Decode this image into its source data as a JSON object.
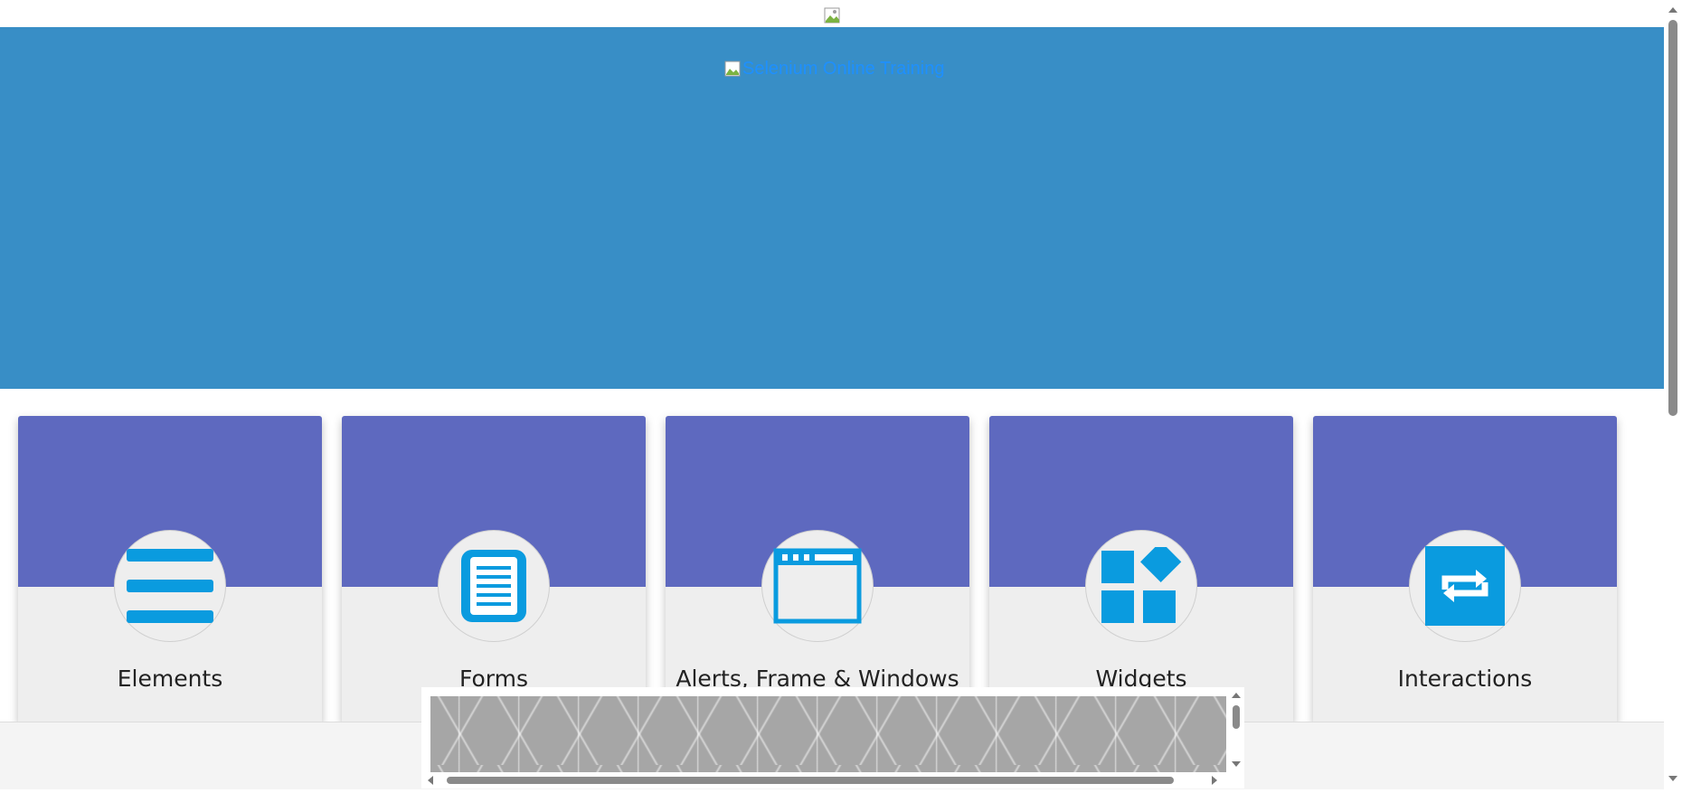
{
  "header": {
    "logo_link_text": "Selenium Online Training"
  },
  "cards": [
    {
      "label": "Elements",
      "icon": "elements-list-icon"
    },
    {
      "label": "Forms",
      "icon": "forms-document-icon"
    },
    {
      "label": "Alerts, Frame & Windows",
      "icon": "browser-window-icon"
    },
    {
      "label": "Widgets",
      "icon": "widgets-blocks-icon"
    },
    {
      "label": "Interactions",
      "icon": "interactions-arrows-icon"
    }
  ],
  "colors": {
    "banner": "#388ec6",
    "card_header": "#5e69bf",
    "card_body": "#eeeeee",
    "icon_blue": "#0a9bdf",
    "link_blue": "#1e90ff"
  }
}
